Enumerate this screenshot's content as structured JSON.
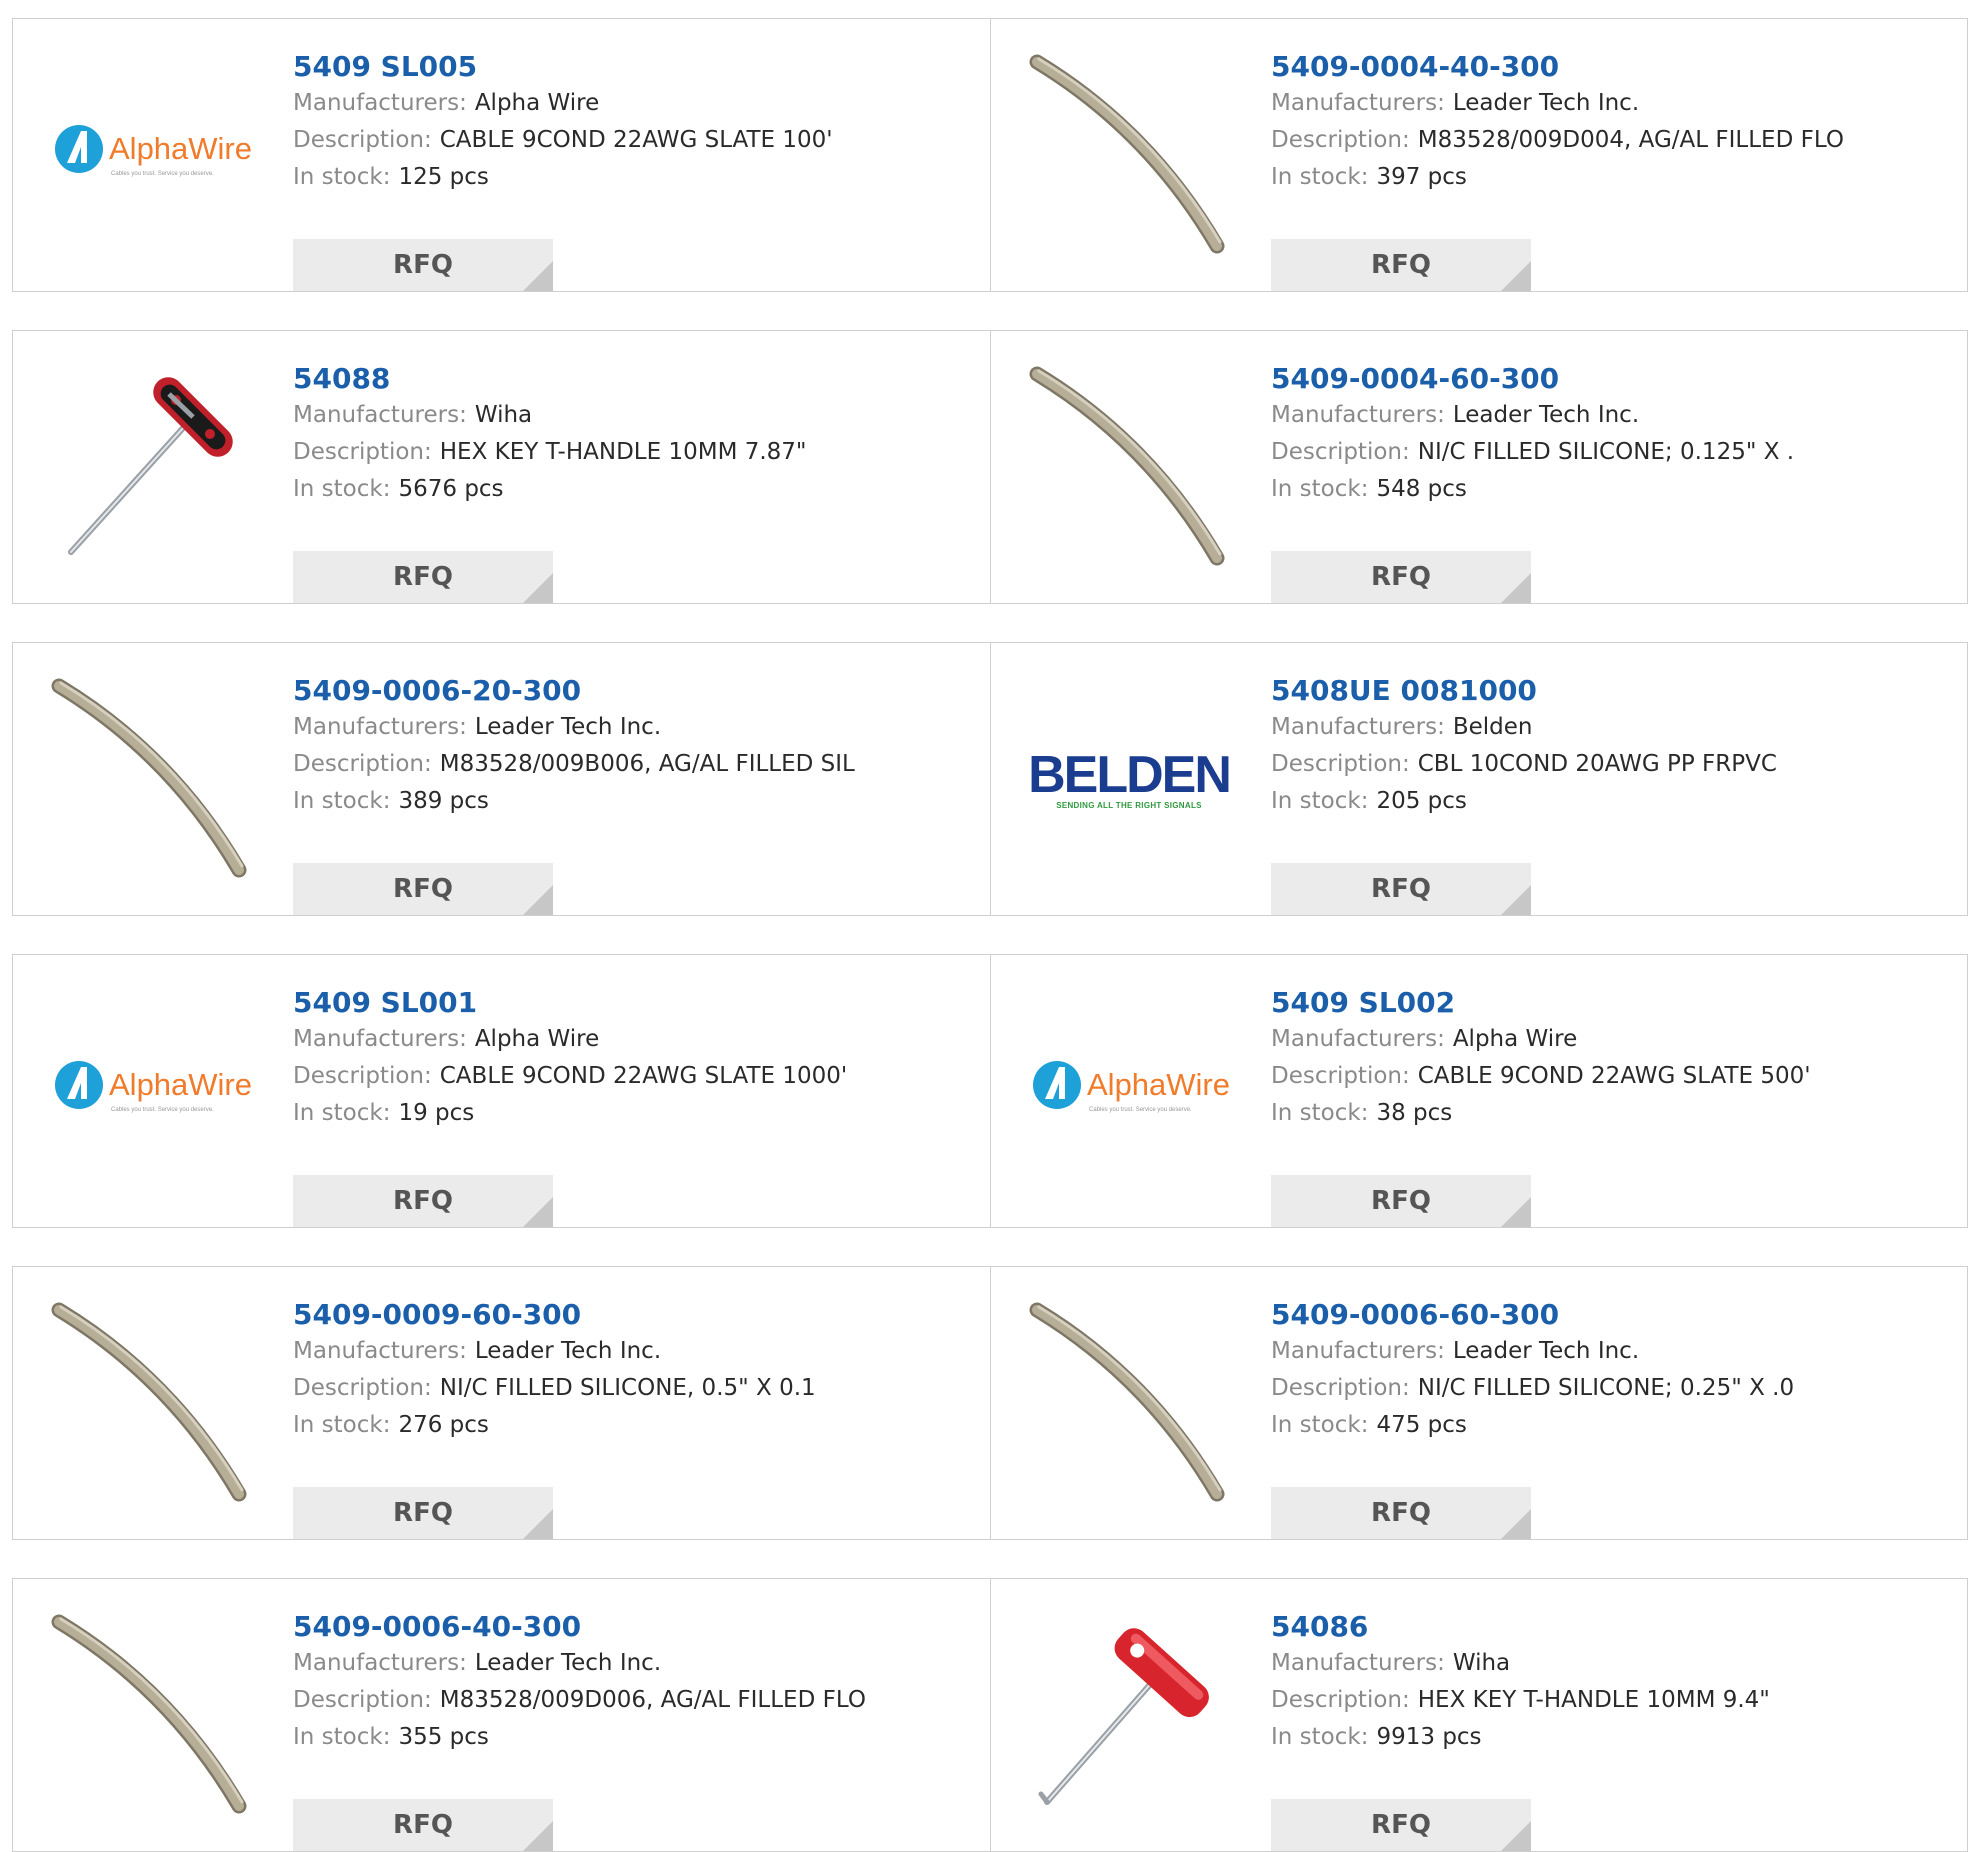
{
  "labels": {
    "manufacturers": "Manufacturers:",
    "description": "Description:",
    "in_stock": "In stock:",
    "rfq": "RFQ"
  },
  "colors": {
    "part_number": "#1b5faa",
    "label": "#8a8a8a",
    "rfq_bg": "#ebebeb",
    "border": "#cfcfcf"
  },
  "logos": {
    "alphawire": {
      "name": "AlphaWire",
      "tagline": "Cables you trust. Service you deserve."
    },
    "belden": {
      "name": "BELDEN",
      "tagline": "SENDING ALL THE RIGHT SIGNALS"
    }
  },
  "products": [
    {
      "part_number": "5409 SL005",
      "manufacturer": "Alpha Wire",
      "description": "CABLE 9COND 22AWG SLATE 100'",
      "stock": "125 pcs",
      "image": "alphawire-logo"
    },
    {
      "part_number": "5409-0004-40-300",
      "manufacturer": "Leader Tech Inc.",
      "description": "M83528/009D004, AG/AL FILLED FLO",
      "stock": "397 pcs",
      "image": "gasket-strip"
    },
    {
      "part_number": "54088",
      "manufacturer": "Wiha",
      "description": "HEX KEY T-HANDLE 10MM 7.87\"",
      "stock": "5676 pcs",
      "image": "hex-key-black-red"
    },
    {
      "part_number": "5409-0004-60-300",
      "manufacturer": "Leader Tech Inc.",
      "description": "NI/C FILLED SILICONE; 0.125\" X .",
      "stock": "548 pcs",
      "image": "gasket-strip"
    },
    {
      "part_number": "5409-0006-20-300",
      "manufacturer": "Leader Tech Inc.",
      "description": "M83528/009B006, AG/AL FILLED SIL",
      "stock": "389 pcs",
      "image": "gasket-strip"
    },
    {
      "part_number": "5408UE 0081000",
      "manufacturer": "Belden",
      "description": "CBL 10COND 20AWG PP FRPVC",
      "stock": "205 pcs",
      "image": "belden-logo"
    },
    {
      "part_number": "5409 SL001",
      "manufacturer": "Alpha Wire",
      "description": "CABLE 9COND 22AWG SLATE 1000'",
      "stock": "19 pcs",
      "image": "alphawire-logo"
    },
    {
      "part_number": "5409 SL002",
      "manufacturer": "Alpha Wire",
      "description": "CABLE 9COND 22AWG SLATE 500'",
      "stock": "38 pcs",
      "image": "alphawire-logo"
    },
    {
      "part_number": "5409-0009-60-300",
      "manufacturer": "Leader Tech Inc.",
      "description": "NI/C FILLED SILICONE, 0.5\" X 0.1",
      "stock": "276 pcs",
      "image": "gasket-strip"
    },
    {
      "part_number": "5409-0006-60-300",
      "manufacturer": "Leader Tech Inc.",
      "description": "NI/C FILLED SILICONE; 0.25\" X .0",
      "stock": "475 pcs",
      "image": "gasket-strip"
    },
    {
      "part_number": "5409-0006-40-300",
      "manufacturer": "Leader Tech Inc.",
      "description": "M83528/009D006, AG/AL FILLED FLO",
      "stock": "355 pcs",
      "image": "gasket-strip"
    },
    {
      "part_number": "54086",
      "manufacturer": "Wiha",
      "description": "HEX KEY T-HANDLE 10MM 9.4\"",
      "stock": "9913 pcs",
      "image": "hex-key-red"
    }
  ]
}
